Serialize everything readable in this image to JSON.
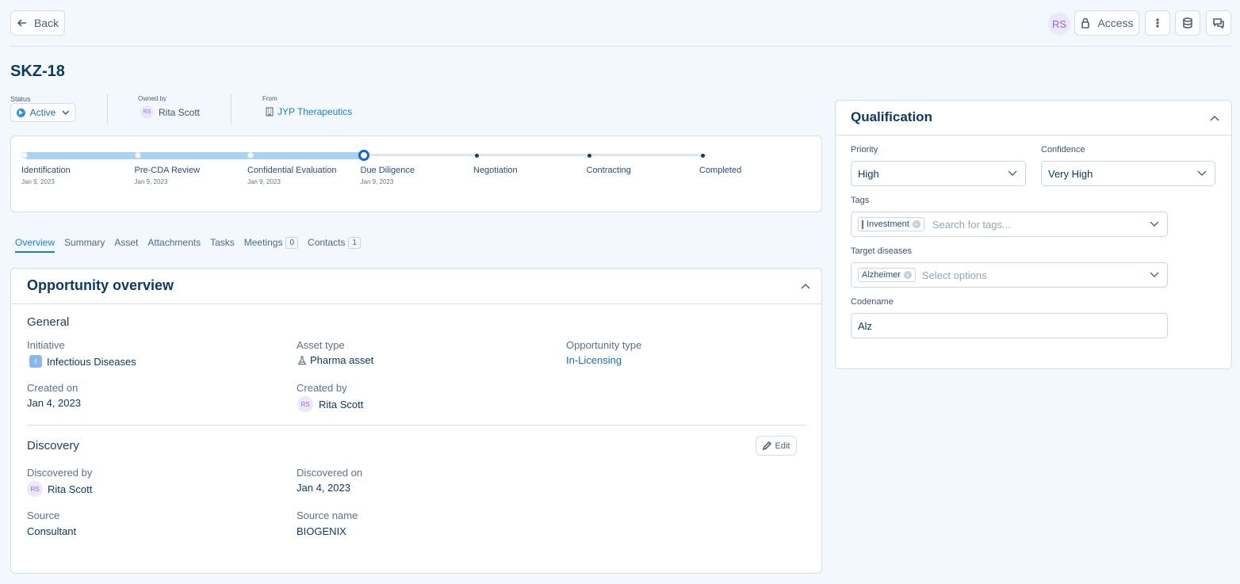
{
  "header": {
    "back_label": "Back",
    "user_initials": "RS",
    "access_label": "Access"
  },
  "page": {
    "title": "SKZ-18",
    "status_label": "Status",
    "status_value": "Active",
    "owned_by_label": "Owned by",
    "owner_initials": "RS",
    "owner_name": "Rita Scott",
    "from_label": "From",
    "from_value": "JYP Therapeutics"
  },
  "pipeline": {
    "progress_fraction": 0.5,
    "steps": [
      {
        "label": "Identification",
        "date": "Jan 9, 2023"
      },
      {
        "label": "Pre-CDA Review",
        "date": "Jan 9, 2023"
      },
      {
        "label": "Confidential Evaluation",
        "date": "Jan 9, 2023"
      },
      {
        "label": "Due Diligence",
        "date": "Jan 9, 2023"
      },
      {
        "label": "Negotiation",
        "date": ""
      },
      {
        "label": "Contracting",
        "date": ""
      },
      {
        "label": "Completed",
        "date": ""
      }
    ],
    "current_index": 3
  },
  "tabs": [
    {
      "label": "Overview",
      "count": ""
    },
    {
      "label": "Summary",
      "count": ""
    },
    {
      "label": "Asset",
      "count": ""
    },
    {
      "label": "Attachments",
      "count": ""
    },
    {
      "label": "Tasks",
      "count": ""
    },
    {
      "label": "Meetings",
      "count": "0"
    },
    {
      "label": "Contacts",
      "count": "1"
    }
  ],
  "overview": {
    "title": "Opportunity overview",
    "general_title": "General",
    "initiative_label": "Initiative",
    "initiative_value": "Infectious Diseases",
    "initiative_badge": "I",
    "asset_type_label": "Asset type",
    "asset_type_value": "Pharma asset",
    "opportunity_type_label": "Opportunity type",
    "opportunity_type_value": "In-Licensing",
    "created_on_label": "Created on",
    "created_on_value": "Jan 4, 2023",
    "created_by_label": "Created by",
    "created_by_initials": "RS",
    "created_by_value": "Rita Scott",
    "discovery_title": "Discovery",
    "edit_label": "Edit",
    "discovered_by_label": "Discovered by",
    "discovered_by_initials": "RS",
    "discovered_by_value": "Rita Scott",
    "discovered_on_label": "Discovered on",
    "discovered_on_value": "Jan 4, 2023",
    "source_label": "Source",
    "source_value": "Consultant",
    "source_name_label": "Source name",
    "source_name_value": "BIOGENIX"
  },
  "qualification": {
    "title": "Qualification",
    "priority_label": "Priority",
    "priority_value": "High",
    "confidence_label": "Confidence",
    "confidence_value": "Very High",
    "tags_label": "Tags",
    "tag_chip": "Investment",
    "tags_placeholder": "Search for tags...",
    "diseases_label": "Target diseases",
    "disease_chip": "Alzheimer",
    "diseases_placeholder": "Select options",
    "codename_label": "Codename",
    "codename_value": "Alz"
  },
  "colors": {
    "accent": "#1a7fd6",
    "progress_fill": "#a9d2f5",
    "progress_track": "#dde7f1",
    "node_active": "#1565d8"
  }
}
